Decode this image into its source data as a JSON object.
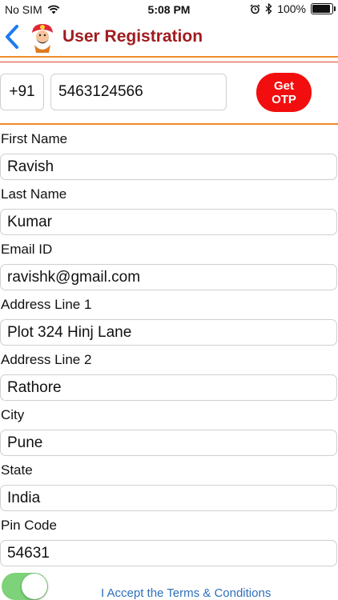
{
  "status_bar": {
    "carrier": "No SIM",
    "time": "5:08 PM",
    "battery": "100%"
  },
  "header": {
    "title": "User Registration"
  },
  "phone": {
    "country_code": "+91",
    "number": "5463124566",
    "otp_button": "Get OTP"
  },
  "form": {
    "first_name": {
      "label": "First Name",
      "value": "Ravish"
    },
    "last_name": {
      "label": "Last Name",
      "value": "Kumar"
    },
    "email": {
      "label": "Email ID",
      "value": "ravishk@gmail.com"
    },
    "address1": {
      "label": "Address Line 1",
      "value": "Plot 324 Hinj Lane"
    },
    "address2": {
      "label": "Address Line 2",
      "value": "Rathore"
    },
    "city": {
      "label": "City",
      "value": "Pune"
    },
    "state": {
      "label": "State",
      "value": "India"
    },
    "pin": {
      "label": "Pin Code",
      "value": "54631"
    }
  },
  "terms": {
    "text": "I Accept the Terms & Conditions",
    "accepted": true
  },
  "colors": {
    "title": "#a01c1f",
    "accent_line": "#f08a28",
    "otp_button": "#f20e0e",
    "toggle_on": "#7ed27a",
    "link": "#2f6fba"
  }
}
